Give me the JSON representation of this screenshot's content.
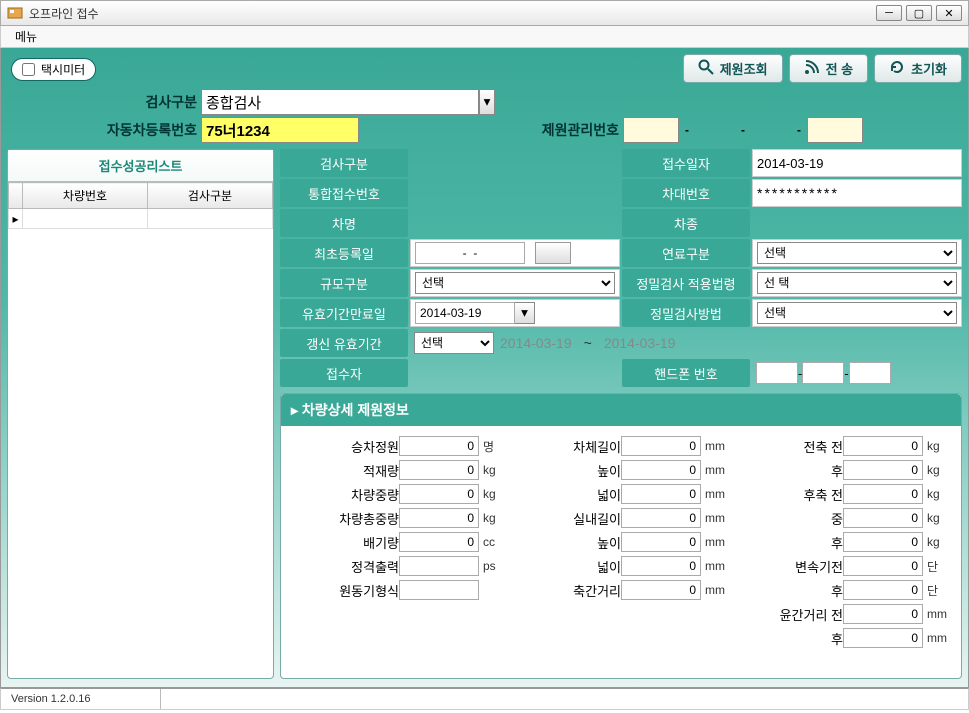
{
  "window": {
    "title": "오프라인 접수"
  },
  "menu": {
    "item1": "메뉴"
  },
  "chip": {
    "label": "택시미터"
  },
  "buttons": {
    "lookup": "제원조회",
    "send": "전 송",
    "reset": "초기화"
  },
  "search": {
    "kind_label": "검사구분",
    "kind_value": "종합검사",
    "carno_label": "자동차등록번호",
    "carno_value": "75너1234",
    "mgmt_label": "제원관리번호",
    "mgmt_dash": "-"
  },
  "successlist": {
    "title": "접수성공리스트",
    "col1": "차량번호",
    "col2": "검사구분"
  },
  "form": {
    "r1l": "검사구분",
    "r1r": "접수일자",
    "r1r_val": "2014-03-19",
    "r2l": "통합접수번호",
    "r2r": "차대번호",
    "r2r_val": "***********",
    "r3l": "차명",
    "r3r": "차종",
    "r4l": "최초등록일",
    "r4l_val": "-  -",
    "r4r": "연료구분",
    "r4r_val": "선택",
    "r5l": "규모구분",
    "r5l_val": "선택",
    "r5r": "정밀검사 적용법령",
    "r5r_val": "선 택",
    "r6l": "유효기간만료일",
    "r6l_val": "2014-03-19",
    "r6r": "정밀검사방법",
    "r6r_val": "선택",
    "r7l": "갱신 유효기간",
    "r7l_val": "선택",
    "range_from": "2014-03-19",
    "tilde": "~",
    "range_to": "2014-03-19",
    "r8l": "접수자",
    "r8r": "핸드폰 번호",
    "pdash": "-"
  },
  "detail": {
    "title": "▸ 차량상세 제원정보",
    "c1": {
      "seating_l": "승차정원",
      "seating_v": "0",
      "seating_u": "명",
      "load_l": "적재량",
      "load_v": "0",
      "load_u": "kg",
      "curb_l": "차량중량",
      "curb_v": "0",
      "curb_u": "kg",
      "gross_l": "차량총중량",
      "gross_v": "0",
      "gross_u": "kg",
      "disp_l": "배기량",
      "disp_v": "0",
      "disp_u": "cc",
      "rated_l": "정격출력",
      "rated_v": "",
      "rated_u": "ps",
      "engine_l": "원동기형식",
      "engine_v": ""
    },
    "c2": {
      "blen_l": "차체길이",
      "blen_v": "0",
      "blen_u": "mm",
      "hgt_l": "높이",
      "hgt_v": "0",
      "hgt_u": "mm",
      "wid_l": "넓이",
      "wid_v": "0",
      "wid_u": "mm",
      "inlen_l": "실내길이",
      "inlen_v": "0",
      "inlen_u": "mm",
      "inhgt_l": "높이",
      "inhgt_v": "0",
      "inhgt_u": "mm",
      "inwid_l": "넓이",
      "inwid_v": "0",
      "inwid_u": "mm",
      "wheel_l": "축간거리",
      "wheel_v": "0",
      "wheel_u": "mm"
    },
    "c3": {
      "ff_l": "전축 전",
      "ff_v": "0",
      "ff_u": "kg",
      "fr_l": "후",
      "fr_v": "0",
      "fr_u": "kg",
      "rf_l": "후축 전",
      "rf_v": "0",
      "rf_u": "kg",
      "rm_l": "중",
      "rm_v": "0",
      "rm_u": "kg",
      "rr_l": "후",
      "rr_v": "0",
      "rr_u": "kg",
      "gbf_l": "변속기전",
      "gbf_v": "0",
      "gbf_u": "단",
      "gbr_l": "후",
      "gbr_v": "0",
      "gbr_u": "단",
      "trf_l": "윤간거리 전",
      "trf_v": "0",
      "trf_u": "mm",
      "trr_l": "후",
      "trr_v": "0",
      "trr_u": "mm"
    }
  },
  "status": {
    "version": "Version 1.2.0.16"
  }
}
